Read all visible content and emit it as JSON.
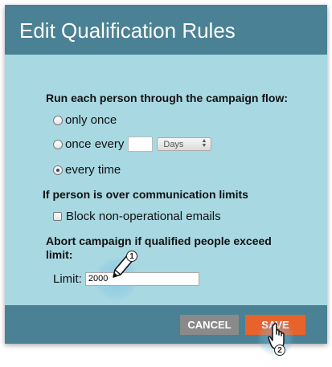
{
  "dialog": {
    "title": "Edit Qualification Rules",
    "campaign_flow": {
      "heading": "Run each person through the campaign flow:",
      "options": [
        {
          "label": "only once",
          "selected": false
        },
        {
          "label": "once every",
          "selected": false
        },
        {
          "label": "every time",
          "selected": true
        }
      ],
      "interval_value": "",
      "interval_unit": "Days"
    },
    "communication_limits": {
      "heading": "If person is over communication limits",
      "block_label": "Block non-operational emails",
      "block_checked": false
    },
    "abort": {
      "heading_line1": "Abort campaign if qualified people exceed",
      "heading_line2": "limit:",
      "limit_label": "Limit:",
      "limit_value": "2000"
    },
    "footer": {
      "cancel_label": "CANCEL",
      "save_label": "SAVE"
    }
  },
  "annotations": {
    "step1": "1",
    "step2": "2"
  }
}
